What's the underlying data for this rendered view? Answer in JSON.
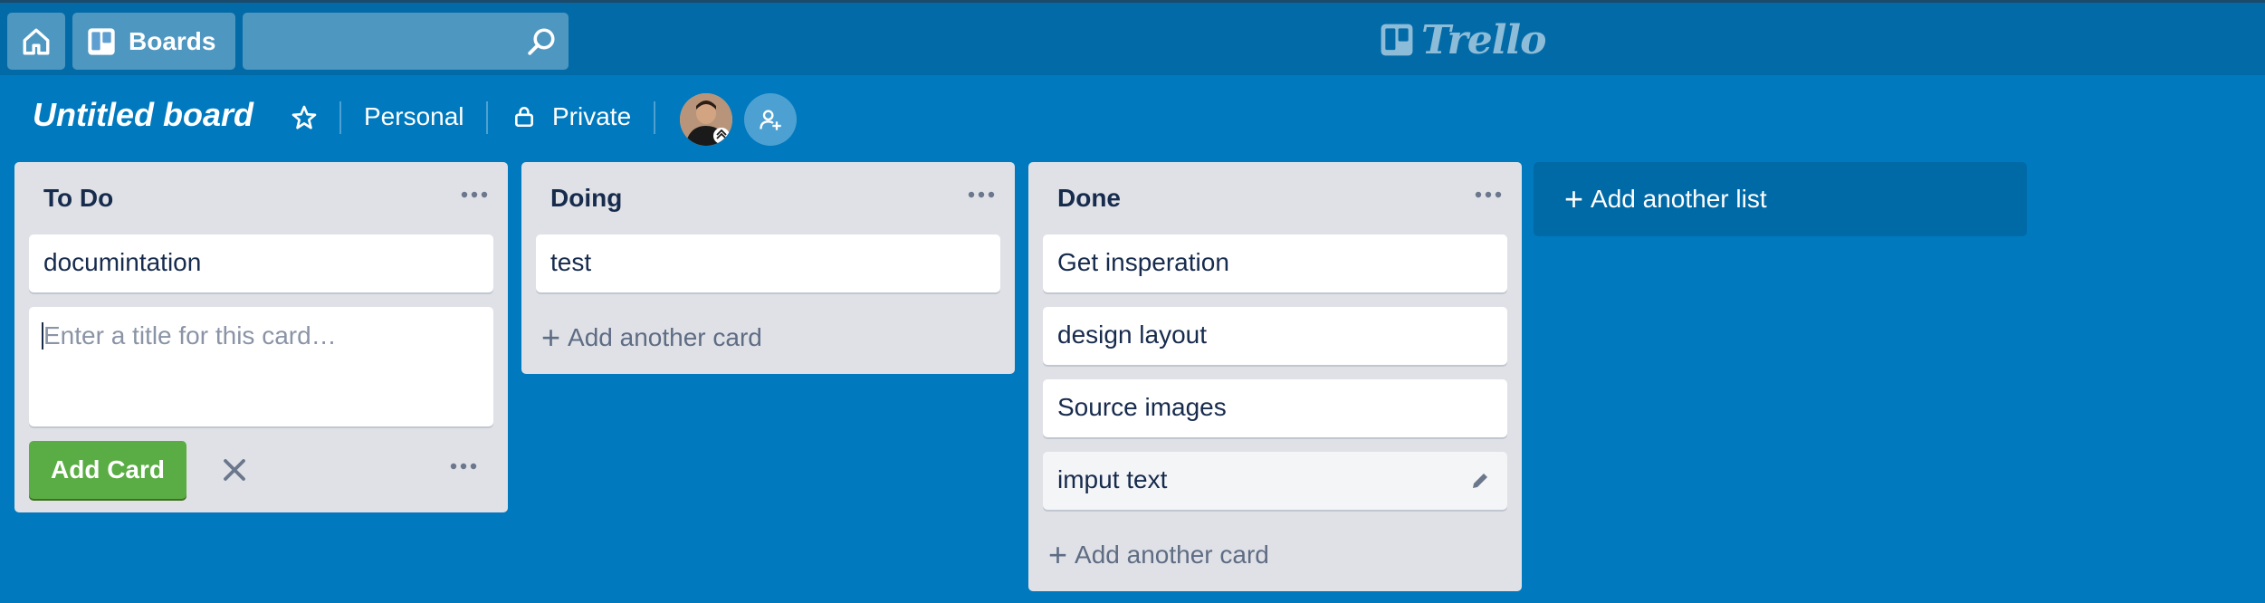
{
  "header": {
    "boards_label": "Boards",
    "search": {
      "placeholder": ""
    },
    "logo_text": "Trello"
  },
  "board": {
    "title": "Untitled board",
    "team": "Personal",
    "visibility": "Private"
  },
  "lists": [
    {
      "title": "To Do",
      "cards": [
        "documintation"
      ],
      "composer": {
        "placeholder": "Enter a title for this card…",
        "add_button": "Add Card"
      }
    },
    {
      "title": "Doing",
      "cards": [
        "test"
      ],
      "add_card_label": "Add another card"
    },
    {
      "title": "Done",
      "cards": [
        "Get insperation",
        "design layout",
        "Source images",
        "imput text"
      ],
      "add_card_label": "Add another card"
    }
  ],
  "add_list_label": "Add another list",
  "colors": {
    "background": "#0079bf",
    "header": "#026aa7",
    "list": "#dfe1e6",
    "add_button": "#5aac44"
  }
}
